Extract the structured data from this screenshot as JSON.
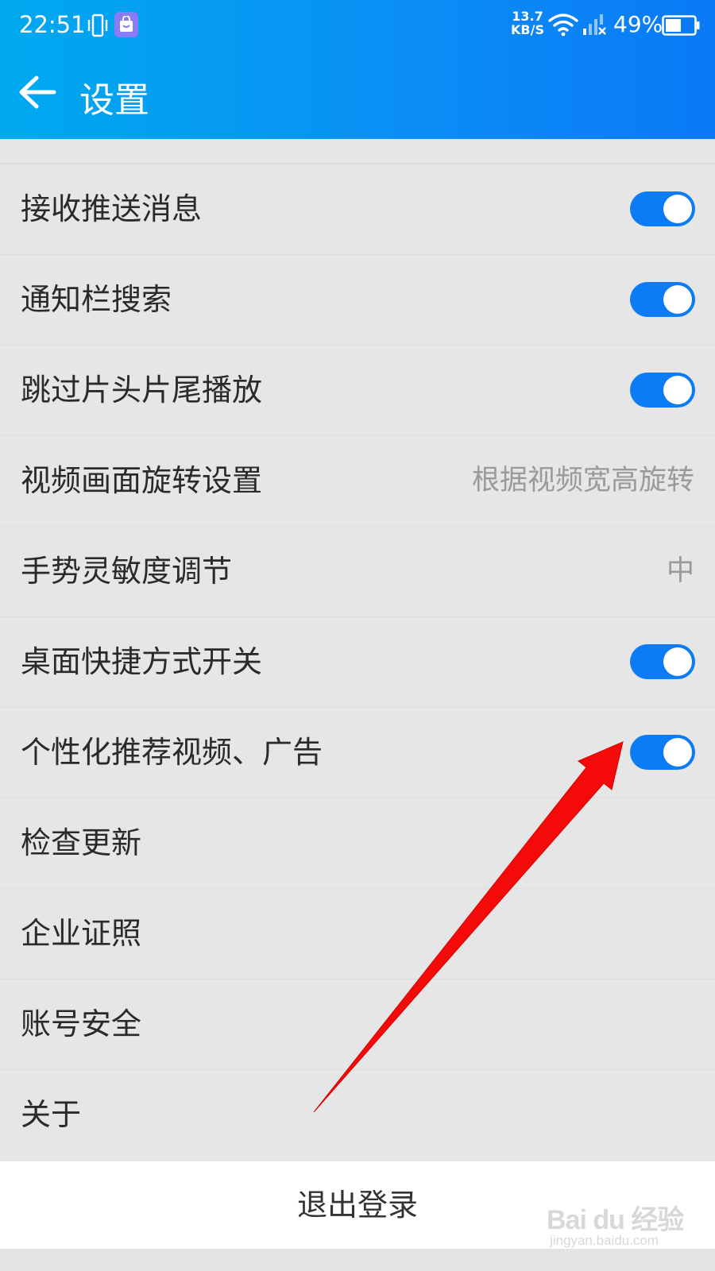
{
  "status_bar": {
    "time": "22:51",
    "net_speed_value": "13.7",
    "net_speed_unit": "KB/S",
    "battery_percent": "49%",
    "icons": [
      "vibrate-icon",
      "app-notification-icon",
      "wifi-icon",
      "signal-icon",
      "battery-icon"
    ]
  },
  "app_bar": {
    "title": "设置",
    "back_icon": "arrow-left-icon",
    "background_start": "#00a9ef",
    "background_end": "#0a79f6"
  },
  "settings": {
    "items": [
      {
        "label": "接收推送消息",
        "toggle_on": true
      },
      {
        "label": "通知栏搜索",
        "toggle_on": true
      },
      {
        "label": "跳过片头片尾播放",
        "toggle_on": true
      },
      {
        "label": "视频画面旋转设置",
        "value": "根据视频宽高旋转"
      },
      {
        "label": "手势灵敏度调节",
        "value": "中"
      },
      {
        "label": "桌面快捷方式开关",
        "toggle_on": true
      },
      {
        "label": "个性化推荐视频、广告",
        "toggle_on": true
      },
      {
        "label": "检查更新"
      },
      {
        "label": "企业证照"
      },
      {
        "label": "账号安全"
      },
      {
        "label": "关于"
      }
    ]
  },
  "logout": {
    "label": "退出登录"
  },
  "colors": {
    "toggle_on": "#0b7cf5",
    "list_background": "#e6e6e6",
    "annotation_arrow": "#f50a0a"
  },
  "watermark": {
    "logo_text": "Bai du 经验",
    "site": "jingyan.baidu.com"
  }
}
